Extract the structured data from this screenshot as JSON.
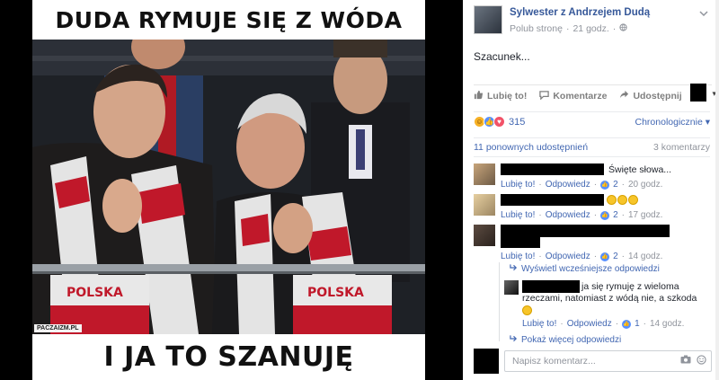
{
  "meme": {
    "top_caption": "DUDA RYMUJE SIĘ Z WÓDA",
    "bottom_caption": "I JA TO SZANUJĘ",
    "watermark": "PACZAIZM.PL",
    "scarf_text_left": "POLSKA",
    "scarf_text_right": "POLSKA"
  },
  "post": {
    "page_name": "Sylwester z Andrzejem Dudą",
    "like_page": "Polub stronę",
    "separator": "·",
    "time": "21 godz.",
    "privacy_icon": "globe-icon",
    "text": "Szacunek...",
    "actions": {
      "like": "Lubię to!",
      "comment": "Komentarze",
      "share": "Udostępnij"
    },
    "reactions_count": "315",
    "order": "Chronologicznie",
    "shares": "11 ponownych udostępnień",
    "comments_count": "3 komentarzy"
  },
  "comments": [
    {
      "text": "Święte słowa...",
      "like": "Lubię to!",
      "reply": "Odpowiedz",
      "likes": "2",
      "time": "20 godz."
    },
    {
      "like": "Lubię to!",
      "reply": "Odpowiedz",
      "likes": "2",
      "time": "17 godz."
    },
    {
      "like": "Lubię to!",
      "reply": "Odpowiedz",
      "likes": "2",
      "time": "14 godz."
    }
  ],
  "replies": {
    "earlier": "Wyświetl wcześniejsze odpowiedzi",
    "reply_text_line1": "ja się rymuję z wieloma",
    "reply_text_line2": "rzeczami, natomiast z wódą nie, a szkoda",
    "reply_like": "Lubię to!",
    "reply_reply": "Odpowiedz",
    "reply_likes": "1",
    "reply_time": "14 godz.",
    "more": "Pokaż więcej odpowiedzi"
  },
  "composer": {
    "placeholder": "Napisz komentarz..."
  },
  "colors": {
    "link": "#4267b2",
    "page_name": "#365899",
    "meta": "#90949c",
    "like_blue": "#5890ff"
  }
}
